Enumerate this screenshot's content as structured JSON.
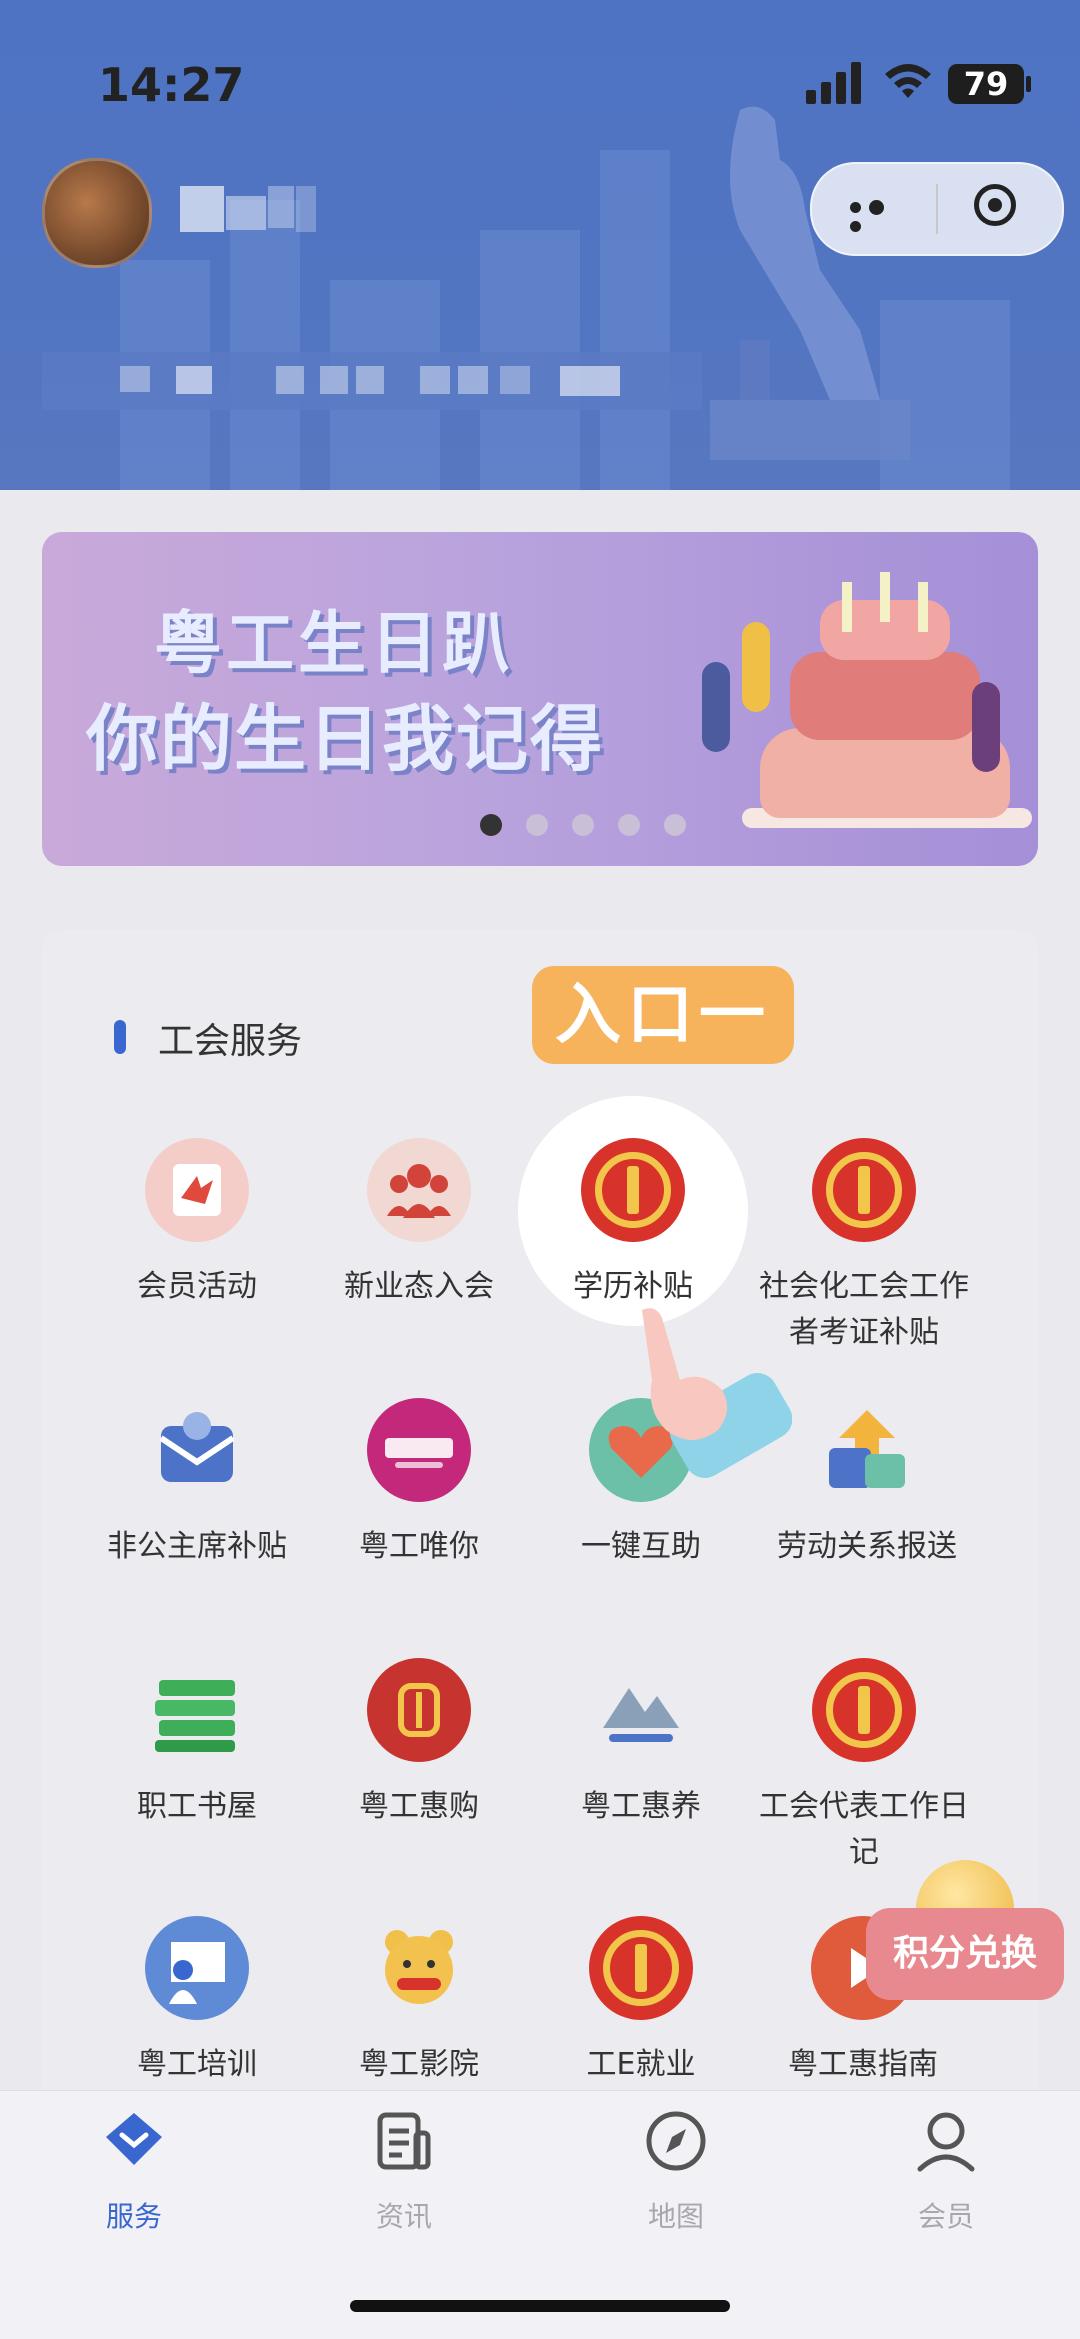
{
  "status_bar": {
    "time": "14:27",
    "battery": "79"
  },
  "banner": {
    "title": "粤工生日趴",
    "subtitle": "你的生日我记得",
    "page_count": 5,
    "active_page": 1
  },
  "section": {
    "title": "工会服务"
  },
  "callout": {
    "label": "入口一"
  },
  "services": [
    {
      "label": "会员活动",
      "icon": "member-activity-icon"
    },
    {
      "label": "新业态入会",
      "icon": "new-industry-join-icon"
    },
    {
      "label": "学历补贴",
      "icon": "union-emblem-icon"
    },
    {
      "label": "社会化工会工作者考证补贴",
      "icon": "union-emblem-icon"
    },
    {
      "label": "非公主席补贴",
      "icon": "wallet-subsidy-icon"
    },
    {
      "label": "粤工唯你",
      "icon": "vip-shop-icon"
    },
    {
      "label": "一键互助",
      "icon": "heart-hands-icon"
    },
    {
      "label": "劳动关系报送",
      "icon": "report-upload-icon"
    },
    {
      "label": "职工书屋",
      "icon": "books-icon"
    },
    {
      "label": "粤工惠购",
      "icon": "wheat-shop-icon"
    },
    {
      "label": "粤工惠养",
      "icon": "mountain-care-icon"
    },
    {
      "label": "工会代表工作日记",
      "icon": "union-emblem-icon"
    },
    {
      "label": "粤工培训",
      "icon": "teacher-training-icon"
    },
    {
      "label": "粤工影院",
      "icon": "bear-cinema-icon"
    },
    {
      "label": "工E就业",
      "icon": "union-emblem-icon"
    },
    {
      "label": "粤工惠指南",
      "icon": "play-guide-icon"
    }
  ],
  "floating": {
    "points_label": "积分兑换"
  },
  "tabbar": [
    {
      "label": "服务",
      "active": true
    },
    {
      "label": "资讯",
      "active": false
    },
    {
      "label": "地图",
      "active": false
    },
    {
      "label": "会员",
      "active": false
    }
  ],
  "colors": {
    "accent": "#3a66d0",
    "header": "#4e73c3",
    "callout": "#f6b35b",
    "emblem_red": "#d8332a",
    "emblem_gold": "#f2c64a"
  }
}
